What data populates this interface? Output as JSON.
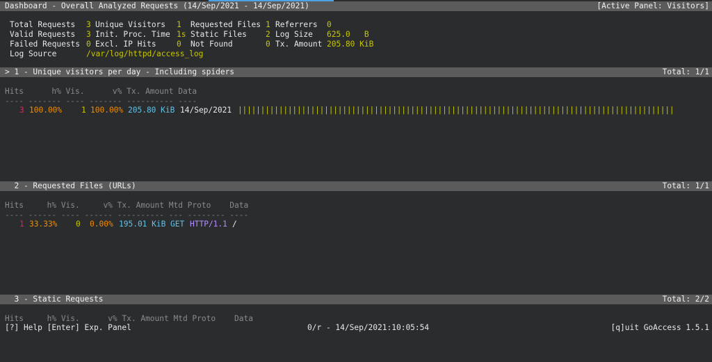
{
  "header": {
    "title": "Dashboard - Overall Analyzed Requests (14/Sep/2021 - 14/Sep/2021)",
    "active_panel": "[Active Panel: Visitors]"
  },
  "stats": {
    "total_requests_label": "Total Requests",
    "total_requests": "3",
    "valid_requests_label": "Valid Requests",
    "valid_requests": "3",
    "failed_requests_label": "Failed Requests",
    "failed_requests": "0",
    "log_source_label": "Log Source",
    "log_source": "/var/log/httpd/access_log",
    "unique_visitors_label": "Unique Visitors",
    "unique_visitors": "1",
    "init_proc_time_label": "Init. Proc. Time",
    "init_proc_time": "1s",
    "excl_ip_hits_label": "Excl. IP Hits",
    "excl_ip_hits": "0",
    "requested_files_label": "Requested Files",
    "requested_files": "1",
    "static_files_label": "Static Files",
    "static_files": "2",
    "not_found_label": "Not Found",
    "not_found": "0",
    "referrers_label": "Referrers",
    "referrers": "0",
    "log_size_label": "Log Size",
    "log_size": "625.0   B",
    "tx_amount_label": "Tx. Amount",
    "tx_amount": "205.80 KiB"
  },
  "panels": [
    {
      "title": "> 1 - Unique visitors per day - Including spiders",
      "total": "Total: 1/1",
      "header": "Hits      h% Vis.      v% Tx. Amount Data",
      "separator": "---- ------- ---- ------- ---------- ----",
      "row": {
        "hits": "3",
        "hits_pct": "100.00%",
        "visitors": "1",
        "visitors_pct": "100.00%",
        "tx_amount": "205.80 KiB",
        "data": "14/Sep/2021",
        "bar": "||||||||||||||||||||||||||||||||||||||||||||||||||||||||||||||||||||||||||||||||||||||||||||||||"
      }
    },
    {
      "title": "  2 - Requested Files (URLs)",
      "total": "Total: 1/1",
      "header": "Hits     h% Vis.     v% Tx. Amount Mtd Proto    Data",
      "separator": "---- ------ ---- ------ ---------- --- -------- ----",
      "row": {
        "hits": "1",
        "hits_pct": "33.33%",
        "visitors": "0",
        "visitors_pct": "0.00%",
        "tx_amount": "195.01 KiB",
        "method": "GET",
        "proto": "HTTP/1.1",
        "data": "/"
      }
    },
    {
      "title": "  3 - Static Requests",
      "total": "Total: 2/2",
      "header": "Hits     h% Vis.      v% Tx. Amount Mtd Proto    Data"
    }
  ],
  "footer": {
    "help": "[?] Help [Enter] Exp. Panel",
    "status": "0/r - 14/Sep/2021:10:05:54",
    "quit": "[q]uit GoAccess 1.5.1"
  }
}
